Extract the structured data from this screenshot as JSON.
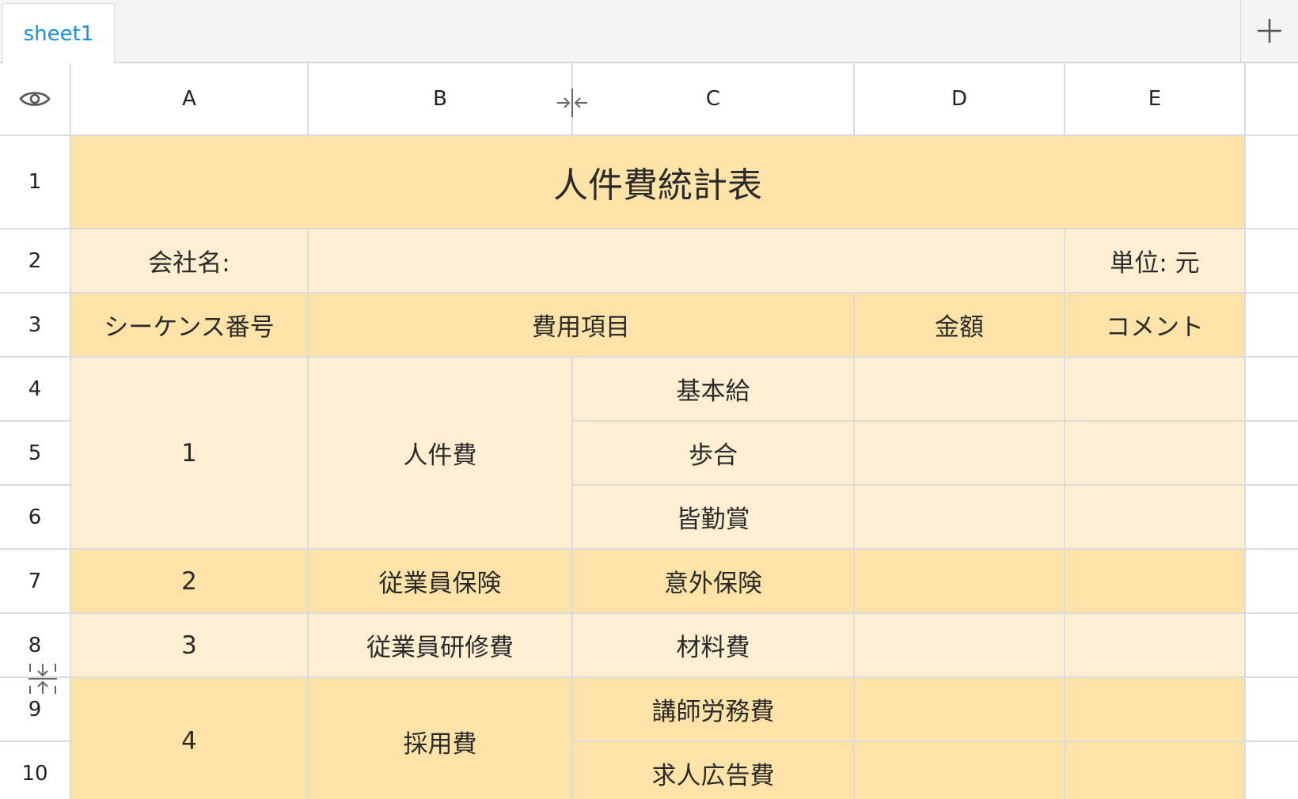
{
  "tabs": {
    "sheet_name": "sheet1",
    "add_icon": "plus-icon"
  },
  "columns": [
    "A",
    "B",
    "C",
    "D",
    "E"
  ],
  "rows": [
    "1",
    "2",
    "3",
    "4",
    "5",
    "6",
    "7",
    "8",
    "9",
    "10"
  ],
  "sheet": {
    "title": "人件費統計表",
    "company_label": "会社名:",
    "unit_label": "単位: 元",
    "header": {
      "seq": "シーケンス番号",
      "item": "費用項目",
      "amount": "金額",
      "comment": "コメント"
    },
    "groups": [
      {
        "seq": "1",
        "category": "人件費",
        "items": [
          "基本給",
          "歩合",
          "皆勤賞"
        ]
      },
      {
        "seq": "2",
        "category": "従業員保険",
        "items": [
          "意外保険"
        ]
      },
      {
        "seq": "3",
        "category": "従業員研修費",
        "items": [
          "材料費"
        ]
      },
      {
        "seq": "4",
        "category": "採用費",
        "items": [
          "講師労務費",
          "求人広告費"
        ]
      }
    ]
  },
  "icons": {
    "visibility": "eye-icon",
    "column_resize": "column-resize-icon",
    "row_resize": "row-resize-icon"
  },
  "colors": {
    "tab_text": "#1a8fe3",
    "header_fill": "#fde3a7",
    "body_fill": "#feefd2",
    "grid_line": "#dcdcdc"
  }
}
